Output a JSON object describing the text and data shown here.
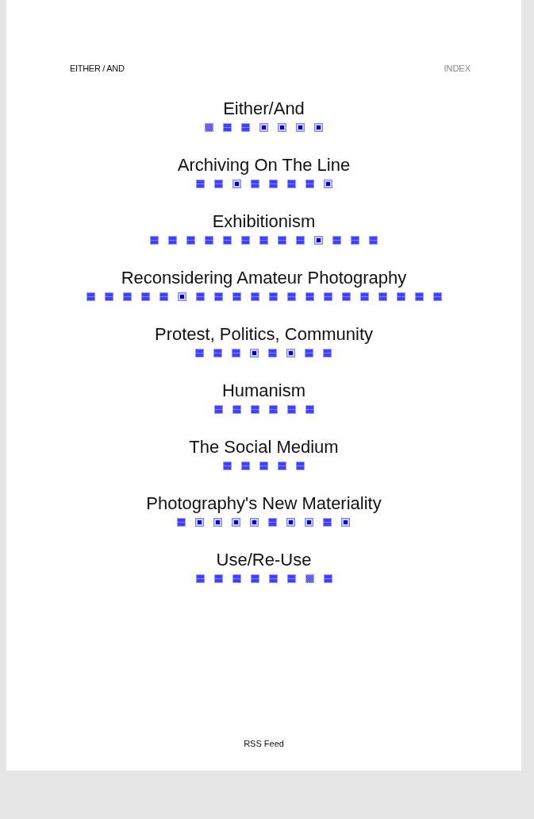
{
  "header": {
    "site_title": "EITHER / AND",
    "index_link": "INDEX"
  },
  "sections": [
    {
      "title": "Either/And",
      "posts": [
        {
          "kind": "checker"
        },
        {
          "kind": "stripe"
        },
        {
          "kind": "stripe"
        },
        {
          "kind": "dot"
        },
        {
          "kind": "dot"
        },
        {
          "kind": "dot"
        },
        {
          "kind": "dot"
        }
      ]
    },
    {
      "title": "Archiving On The Line",
      "posts": [
        {
          "kind": "stripe"
        },
        {
          "kind": "stripe"
        },
        {
          "kind": "dot"
        },
        {
          "kind": "stripe"
        },
        {
          "kind": "stripe"
        },
        {
          "kind": "stripe"
        },
        {
          "kind": "stripe"
        },
        {
          "kind": "dot"
        }
      ]
    },
    {
      "title": "Exhibitionism",
      "posts": [
        {
          "kind": "stripe"
        },
        {
          "kind": "stripe"
        },
        {
          "kind": "stripe"
        },
        {
          "kind": "stripe"
        },
        {
          "kind": "stripe"
        },
        {
          "kind": "stripe"
        },
        {
          "kind": "stripe"
        },
        {
          "kind": "stripe"
        },
        {
          "kind": "stripe"
        },
        {
          "kind": "dot"
        },
        {
          "kind": "stripe"
        },
        {
          "kind": "stripe"
        },
        {
          "kind": "stripe"
        }
      ]
    },
    {
      "title": "Reconsidering Amateur Photography",
      "posts": [
        {
          "kind": "stripe"
        },
        {
          "kind": "stripe"
        },
        {
          "kind": "stripe"
        },
        {
          "kind": "stripe"
        },
        {
          "kind": "stripe"
        },
        {
          "kind": "dot"
        },
        {
          "kind": "stripe"
        },
        {
          "kind": "stripe"
        },
        {
          "kind": "stripe"
        },
        {
          "kind": "stripe"
        },
        {
          "kind": "stripe"
        },
        {
          "kind": "stripe"
        },
        {
          "kind": "stripe"
        },
        {
          "kind": "stripe"
        },
        {
          "kind": "stripe"
        },
        {
          "kind": "stripe"
        },
        {
          "kind": "stripe"
        },
        {
          "kind": "stripe"
        },
        {
          "kind": "stripe"
        },
        {
          "kind": "stripe"
        }
      ]
    },
    {
      "title": "Protest, Politics, Community",
      "posts": [
        {
          "kind": "stripe"
        },
        {
          "kind": "stripe"
        },
        {
          "kind": "stripe"
        },
        {
          "kind": "dot"
        },
        {
          "kind": "stripe"
        },
        {
          "kind": "dot"
        },
        {
          "kind": "stripe"
        },
        {
          "kind": "stripe"
        }
      ]
    },
    {
      "title": "Humanism",
      "posts": [
        {
          "kind": "stripe"
        },
        {
          "kind": "stripe"
        },
        {
          "kind": "stripe"
        },
        {
          "kind": "stripe"
        },
        {
          "kind": "stripe"
        },
        {
          "kind": "stripe"
        }
      ]
    },
    {
      "title": "The Social Medium",
      "posts": [
        {
          "kind": "stripe"
        },
        {
          "kind": "stripe"
        },
        {
          "kind": "stripe"
        },
        {
          "kind": "stripe"
        },
        {
          "kind": "stripe"
        }
      ]
    },
    {
      "title": "Photography's New Materiality",
      "posts": [
        {
          "kind": "stripe"
        },
        {
          "kind": "dot"
        },
        {
          "kind": "dot"
        },
        {
          "kind": "dot"
        },
        {
          "kind": "dot"
        },
        {
          "kind": "stripe"
        },
        {
          "kind": "dot"
        },
        {
          "kind": "dot"
        },
        {
          "kind": "stripe"
        },
        {
          "kind": "dot"
        }
      ]
    },
    {
      "title": "Use/Re-Use",
      "posts": [
        {
          "kind": "stripe"
        },
        {
          "kind": "stripe"
        },
        {
          "kind": "stripe"
        },
        {
          "kind": "stripe"
        },
        {
          "kind": "stripe"
        },
        {
          "kind": "stripe"
        },
        {
          "kind": "checker"
        },
        {
          "kind": "stripe"
        }
      ]
    }
  ],
  "footer": {
    "rss_link": "RSS Feed"
  }
}
